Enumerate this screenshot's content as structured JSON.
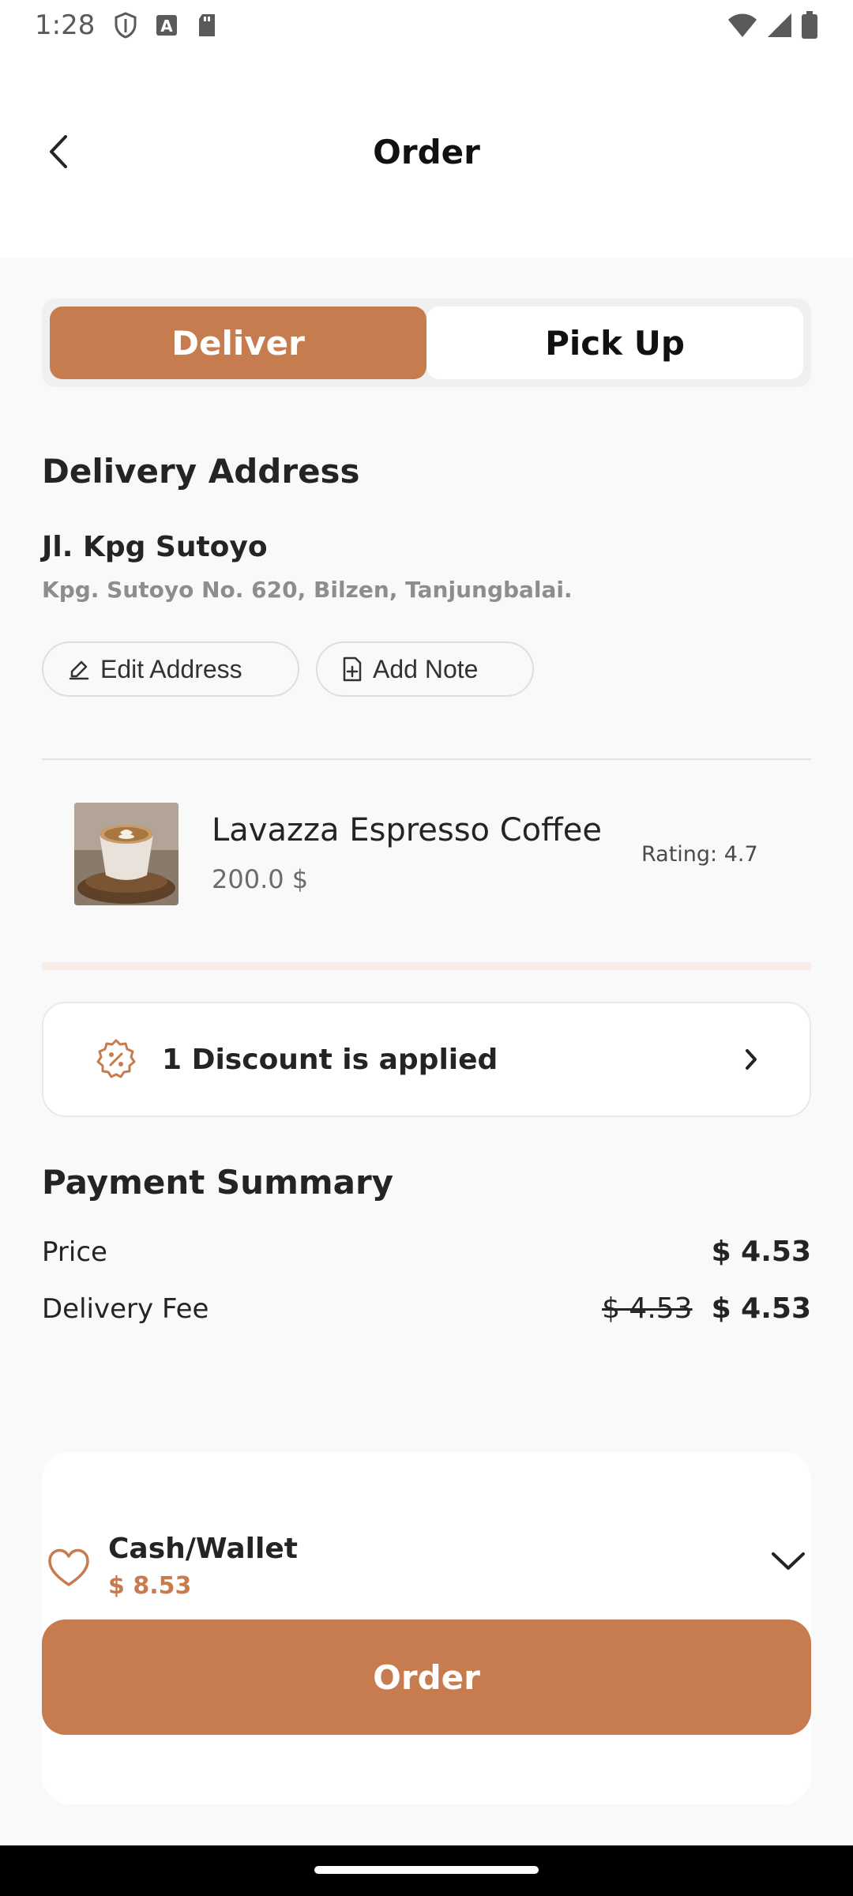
{
  "status_bar": {
    "time": "1:28",
    "icons": [
      "shield-icon",
      "a-icon",
      "sd-card-icon",
      "wifi-icon",
      "signal-icon",
      "battery-icon"
    ]
  },
  "header": {
    "title": "Order",
    "back_icon": "chevron-left-icon"
  },
  "toggle": {
    "deliver_label": "Deliver",
    "pickup_label": "Pick Up",
    "active": "Deliver"
  },
  "delivery": {
    "section_title": "Delivery Address",
    "address_name": "Jl. Kpg Sutoyo",
    "address_detail": "Kpg. Sutoyo No. 620, Bilzen, Tanjungbalai.",
    "edit_label": "Edit Address",
    "note_label": "Add Note"
  },
  "product": {
    "name": "Lavazza Espresso Coffee",
    "price": "200.0 $",
    "rating": "Rating: 4.7"
  },
  "discount": {
    "label": "1 Discount is applied"
  },
  "summary": {
    "title": "Payment Summary",
    "price_label": "Price",
    "price_value": "$ 4.53",
    "fee_label": "Delivery Fee",
    "fee_original": "$ 4.53",
    "fee_value": "$ 4.53"
  },
  "payment": {
    "method": "Cash/Wallet",
    "amount": "$ 8.53",
    "order_label": "Order"
  },
  "colors": {
    "accent": "#C67C4E",
    "accent_light": "#F8EDE6",
    "background": "#F9F9F9"
  }
}
